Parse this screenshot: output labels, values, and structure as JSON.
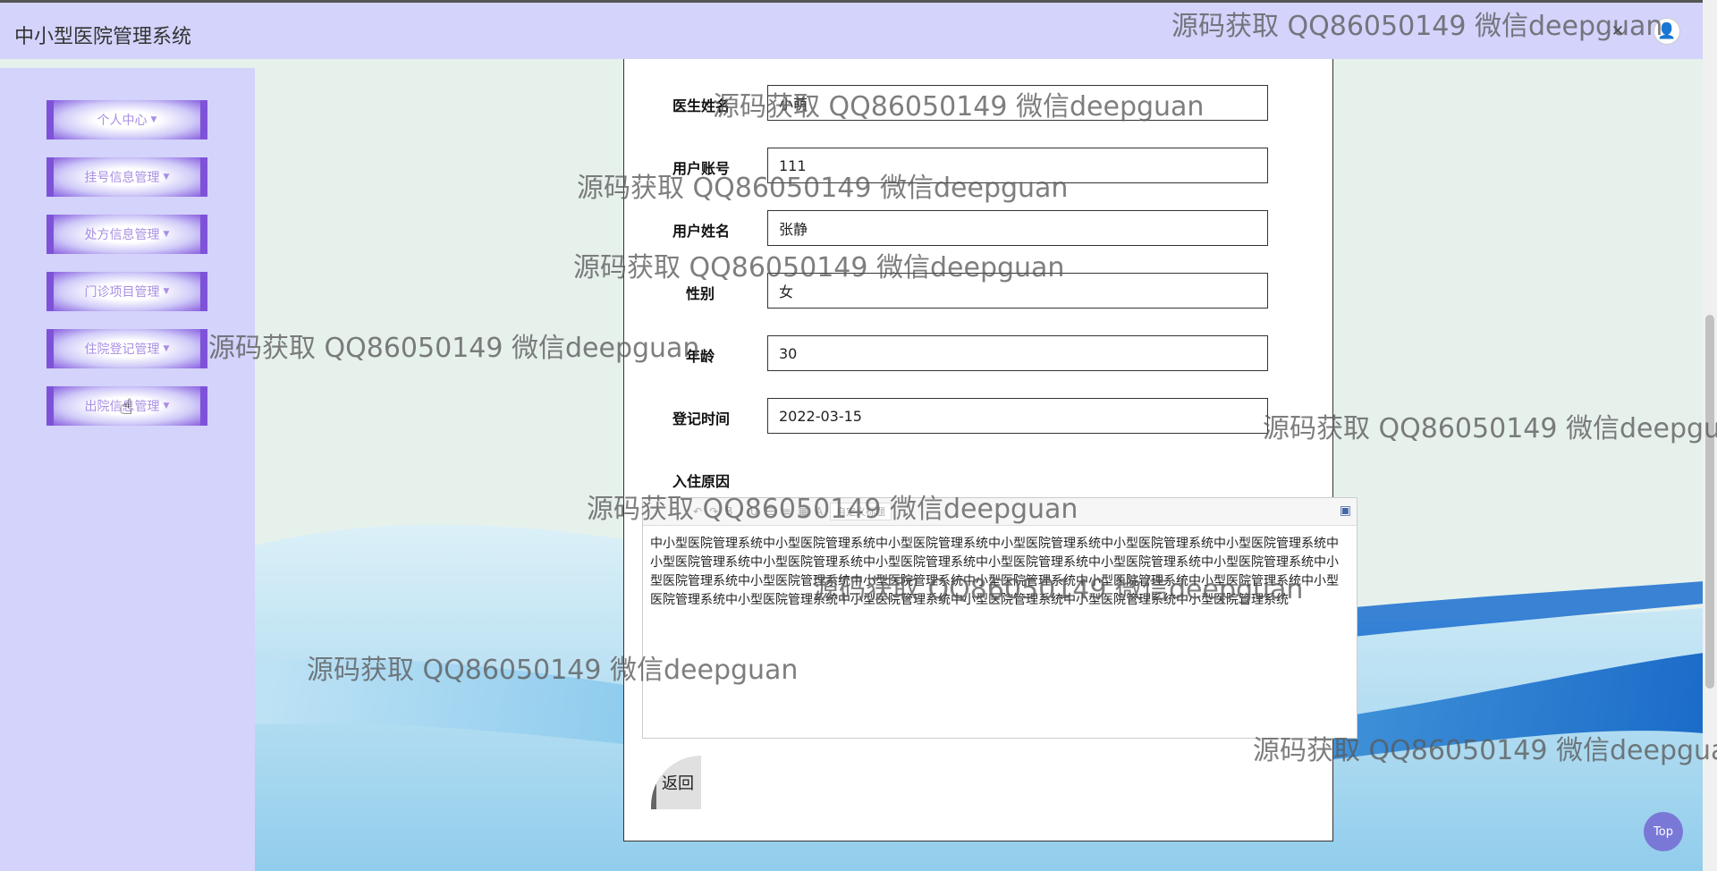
{
  "header": {
    "title": "中小型医院管理系统",
    "close_icon": "close-icon",
    "user_icon": "user-icon"
  },
  "sidebar": {
    "items": [
      {
        "label": "个人中心"
      },
      {
        "label": "挂号信息管理"
      },
      {
        "label": "处方信息管理"
      },
      {
        "label": "门诊项目管理"
      },
      {
        "label": "住院登记管理"
      },
      {
        "label": "出院信息管理"
      }
    ]
  },
  "form": {
    "fields": [
      {
        "label": "医生姓名",
        "value": "小萌"
      },
      {
        "label": "用户账号",
        "value": "111"
      },
      {
        "label": "用户姓名",
        "value": "张静"
      },
      {
        "label": "性别",
        "value": "女"
      },
      {
        "label": "年龄",
        "value": "30"
      },
      {
        "label": "登记时间",
        "value": "2022-03-15"
      }
    ],
    "reason_label": "入住原因",
    "editor": {
      "font_select": "自定义标题",
      "content": "中小型医院管理系统中小型医院管理系统中小型医院管理系统中小型医院管理系统中小型医院管理系统中小型医院管理系统中小型医院管理系统中小型医院管理系统中小型医院管理系统中小型医院管理系统中小型医院管理系统中小型医院管理系统中小型医院管理系统中小型医院管理系统中小型医院管理系统中小型医院管理系统中小型医院管理系统中小型医院管理系统中小型医院管理系统中小型医院管理系统中小型医院管理系统中小型医院管理系统中小型医院管理系统中小型医院管理系统"
    },
    "back_label": "返回"
  },
  "top_button": "Top",
  "watermark": "源码获取 QQ86050149 微信deepguan",
  "colors": {
    "header_bg": "#d3d3fb",
    "sidebar_bg": "#d3d3fb",
    "menu_accent": "#7e52d8",
    "top_button": "#7a78d6"
  }
}
